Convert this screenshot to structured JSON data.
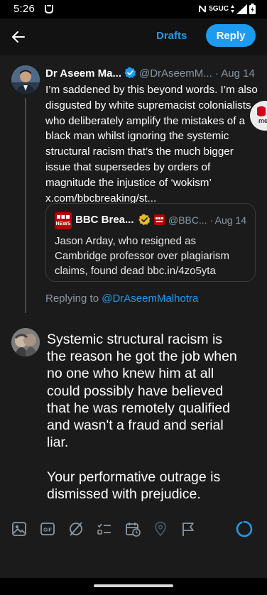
{
  "status_bar": {
    "time": "5:26",
    "network": "5GUC"
  },
  "header": {
    "drafts_label": "Drafts",
    "reply_label": "Reply"
  },
  "tweet": {
    "author_name": "Dr Aseem Ma...",
    "author_handle": "@DrAseemM...",
    "separator": "·",
    "date": "Aug 14",
    "lines": [
      "I’m saddened by this beyond words. I’m also",
      "disgusted by white supremacist  colonialists",
      "who deliberately amplify the mistakes of a",
      "black man whilst  ignoring the systemic",
      "structural racism that’s the much bigger",
      "issue that supersedes by orders of",
      "magnitude the injustice of ‘wokism’",
      "x.com/bbcbreaking/st..."
    ],
    "quoted": {
      "logo_top": "BBC",
      "logo_bottom": "NEWS",
      "name": "BBC Brea...",
      "handle": "@BBC...",
      "separator": "·",
      "date": "Aug 14",
      "lines": [
        "Jason Arday, who resigned as",
        "Cambridge professor over plagiarism",
        "claims, found dead bbc.in/4zo5yta"
      ]
    }
  },
  "replying": {
    "prefix": "Replying to ",
    "handle": "@DrAseemMalhotra"
  },
  "compose": {
    "lines": [
      "Systemic structural racism is",
      "the reason he got the job when",
      "no one who knew him at all",
      "could possibly have believed",
      "that he was remotely qualified",
      "and wasn't a fraud and serial",
      "liar.",
      "",
      "Your performative outrage is",
      "dismissed with prejudice."
    ]
  },
  "toolbar": {
    "icons": [
      "image-icon",
      "gif-icon",
      "grok-icon",
      "poll-icon",
      "schedule-icon",
      "location-icon",
      "flag-icon"
    ],
    "gif_label": "GIF",
    "char_progress": 0.93
  },
  "float_badge": {
    "text": "me"
  },
  "colors": {
    "accent": "#1d9bf0",
    "background": "#1b1b1b",
    "secondary_text": "#8b98a5",
    "bbc_red": "#b80000",
    "gold_badge": "#e8b923"
  }
}
